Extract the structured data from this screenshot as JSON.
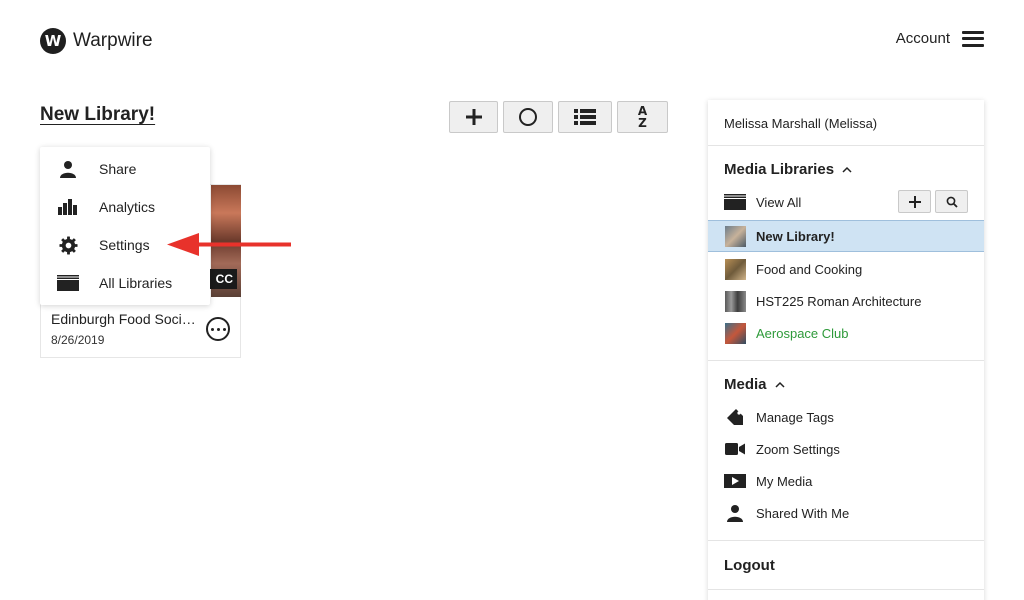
{
  "header": {
    "logo_letter": "W",
    "logo_text": "Warpwire",
    "account_label": "Account"
  },
  "library": {
    "title": "New Library!"
  },
  "toolbar": {
    "buttons": [
      "plus-icon",
      "circle-icon",
      "list-icon",
      "sort-az-icon"
    ],
    "sort_label_top": "A",
    "sort_label_bottom": "Z"
  },
  "card": {
    "title": "Edinburgh Food Soci…",
    "date": "8/26/2019",
    "badge": "CC"
  },
  "menu": {
    "items": [
      {
        "label": "Share",
        "icon": "person-icon"
      },
      {
        "label": "Analytics",
        "icon": "bar-chart-icon"
      },
      {
        "label": "Settings",
        "icon": "gear-icon"
      },
      {
        "label": "All Libraries",
        "icon": "libraries-icon"
      }
    ]
  },
  "panel": {
    "user": "Melissa Marshall (Melissa)",
    "media_libraries_heading": "Media Libraries",
    "view_all": "View All",
    "libraries": [
      {
        "name": "New Library!",
        "selected": true,
        "color": "#222222"
      },
      {
        "name": "Food and Cooking",
        "selected": false,
        "color": "#222222"
      },
      {
        "name": "HST225 Roman Architecture",
        "selected": false,
        "color": "#222222"
      },
      {
        "name": "Aerospace Club",
        "selected": false,
        "color": "#2e9a3a"
      }
    ],
    "media_heading": "Media",
    "media_items": [
      {
        "label": "Manage Tags",
        "icon": "tag-icon"
      },
      {
        "label": "Zoom Settings",
        "icon": "video-camera-icon"
      },
      {
        "label": "My Media",
        "icon": "play-icon"
      },
      {
        "label": "Shared With Me",
        "icon": "person-icon"
      }
    ],
    "logout": "Logout"
  },
  "colors": {
    "selected_row": "#cfe3f3",
    "arrow": "#e8322b",
    "aerospace_link": "#2e9a3a"
  }
}
